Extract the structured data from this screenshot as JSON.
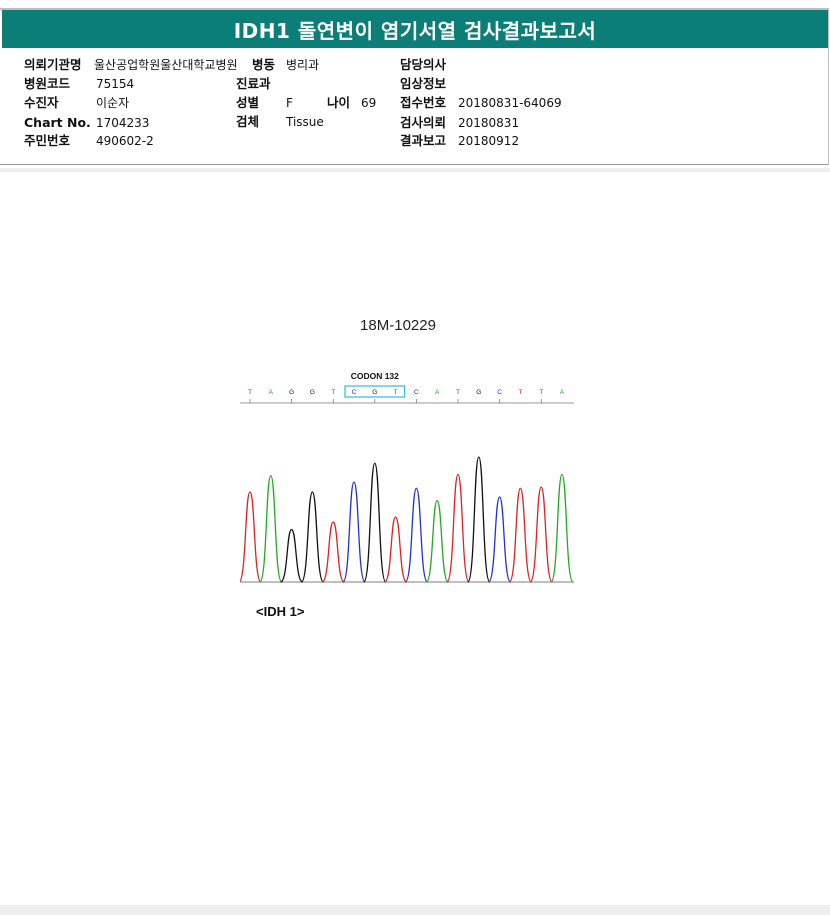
{
  "report": {
    "title": "IDH1 돌연변이 염기서열 검사결과보고서"
  },
  "patient_info": {
    "institution_label": "의뢰기관명",
    "institution_value": "울산공업학원울산대학교병원",
    "ward_label": "병동",
    "ward_value": "병리과",
    "doctor_label": "담당의사",
    "doctor_value": "",
    "hospital_code_label": "병원코드",
    "hospital_code_value": "75154",
    "department_label": "진료과",
    "department_value": "",
    "clinical_info_label": "임상정보",
    "clinical_info_value": "",
    "patient_label": "수진자",
    "patient_value": "이순자",
    "sex_label": "성별",
    "sex_value": "F",
    "age_label": "나이",
    "age_value": "69",
    "receipt_label": "접수번호",
    "receipt_value": "20180831-64069",
    "chart_label": "Chart No.",
    "chart_value": "1704233",
    "specimen_label": "검체",
    "specimen_value": "Tissue",
    "request_date_label": "검사의뢰",
    "request_date_value": "20180831",
    "id_label": "주민번호",
    "id_value": "490602-2",
    "report_date_label": "결과보고",
    "report_date_value": "20180912"
  },
  "figure": {
    "sample_id": "18M-10229",
    "codon_label": "CODON 132",
    "gene_label": "<IDH 1>",
    "bases": [
      "T",
      "A",
      "G",
      "G",
      "T",
      "C",
      "G",
      "T",
      "C",
      "A",
      "T",
      "G",
      "C",
      "T",
      "T",
      "A"
    ],
    "base_colors": {
      "A": "#22aa22",
      "C": "#2233cc",
      "G": "#111111",
      "T": "#dd2222"
    },
    "codon_range": [
      5,
      7
    ],
    "peak_heights": [
      0.72,
      0.85,
      0.42,
      0.72,
      0.48,
      0.8,
      0.95,
      0.52,
      0.75,
      0.65,
      0.86,
      1.0,
      0.68,
      0.75,
      0.76,
      0.86
    ]
  }
}
